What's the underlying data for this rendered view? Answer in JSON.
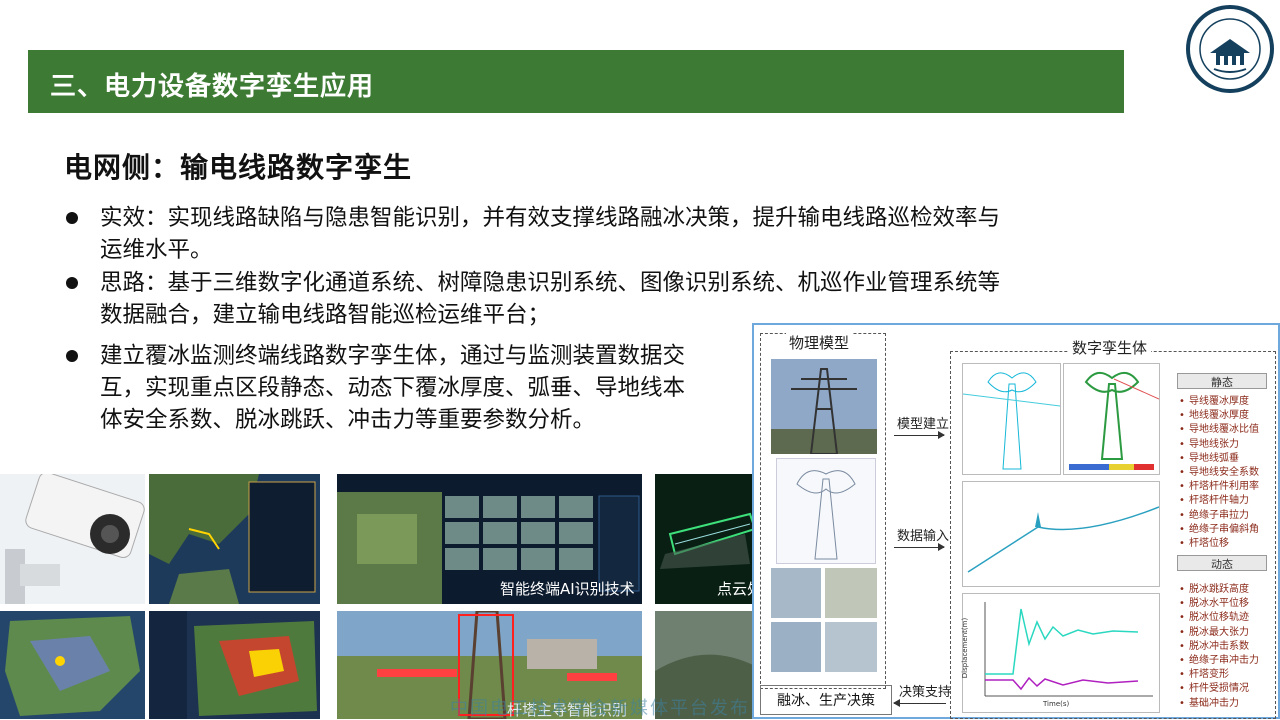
{
  "header": {
    "title": "三、电力设备数字孪生应用"
  },
  "subtitle": "电网侧：输电线路数字孪生",
  "bullets": [
    {
      "line1": "实效：实现线路缺陷与隐患智能识别，并有效支撑线路融冰决策，提升输电线路巡检效率与",
      "line2": "运维水平。"
    },
    {
      "line1": "思路：基于三维数字化通道系统、树障隐患识别系统、图像识别系统、机巡作业管理系统等",
      "line2": "数据融合，建立输电线路智能巡检运维平台；"
    },
    {
      "line1": "建立覆冰监测终端线路数字孪生体，通过与监测装置数据交",
      "line2": "互，实现重点区段静态、动态下覆冰厚度、弧垂、导地线本",
      "line3": "体安全系数、脱冰跳跃、冲击力等重要参数分析。"
    }
  ],
  "thumbnails": {
    "ai_caption": "智能终端AI识别技术",
    "pointcloud_caption": "点云处",
    "tower_caption": "杆塔主导智能识别"
  },
  "diagram": {
    "physical_model": "物理模型",
    "digital_twin": "数字孪生体",
    "arrow_model": "模型建立",
    "arrow_data": "数据输入",
    "arrow_decision": "决策支持",
    "decision_box": "融冰、生产决策",
    "static_header": "静态",
    "static_items": [
      "导线覆冰厚度",
      "地线覆冰厚度",
      "导地线覆冰比值",
      "导地线张力",
      "导地线弧垂",
      "导地线安全系数",
      "杆塔杆件利用率",
      "杆塔杆件轴力",
      "绝缘子串拉力",
      "绝缘子串偏斜角",
      "杆塔位移"
    ],
    "dynamic_header": "动态",
    "dynamic_items": [
      "脱冰跳跃高度",
      "脱冰水平位移",
      "脱冰位移轨迹",
      "脱冰最大张力",
      "脱冰冲击系数",
      "绝缘子串冲击力",
      "杆塔变形",
      "杆件受损情况",
      "基础冲击力"
    ],
    "plot_xlabel": "Time(s)",
    "plot_ylabel": "Displacement(m)"
  },
  "footer": "中国电工技术学会新媒体平台发布",
  "colors": {
    "header_green": "#3d7a33",
    "accent_blue": "#6fa8dc",
    "prop_red": "#8b2a1a"
  }
}
